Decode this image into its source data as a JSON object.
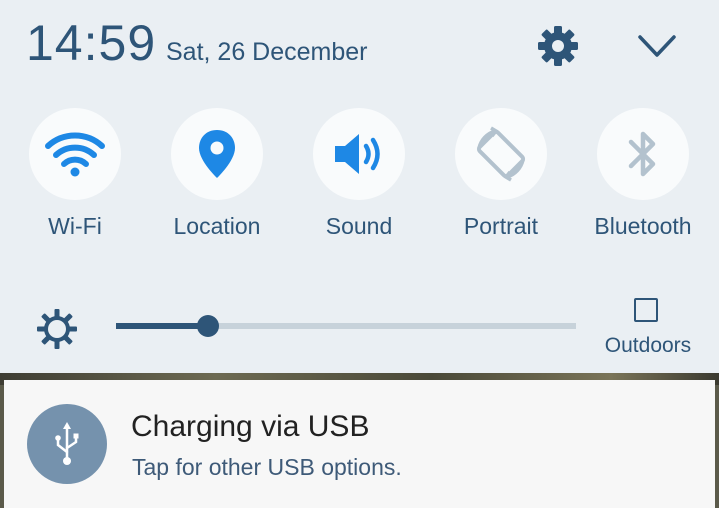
{
  "status": {
    "time": "14:59",
    "date": "Sat, 26 December"
  },
  "header": {
    "settings_icon": "gear-icon",
    "collapse_icon": "chevron-down-icon"
  },
  "quick_settings": [
    {
      "label": "Wi-Fi",
      "icon": "wifi-icon",
      "active": true
    },
    {
      "label": "Location",
      "icon": "location-pin-icon",
      "active": true
    },
    {
      "label": "Sound",
      "icon": "speaker-icon",
      "active": true
    },
    {
      "label": "Portrait",
      "icon": "rotate-icon",
      "active": false
    },
    {
      "label": "Bluetooth",
      "icon": "bluetooth-icon",
      "active": false
    }
  ],
  "brightness": {
    "icon": "brightness-icon",
    "level_fraction": 0.2,
    "outdoors_label": "Outdoors",
    "outdoors_checked": false
  },
  "notification": {
    "icon": "usb-icon",
    "title": "Charging via USB",
    "subtitle": "Tap for other USB options."
  },
  "colors": {
    "accent": "#2e5578",
    "inactive_icon": "#b3c2ce",
    "panel_bg": "#eaeff3",
    "usb_circle": "#7592ad"
  }
}
